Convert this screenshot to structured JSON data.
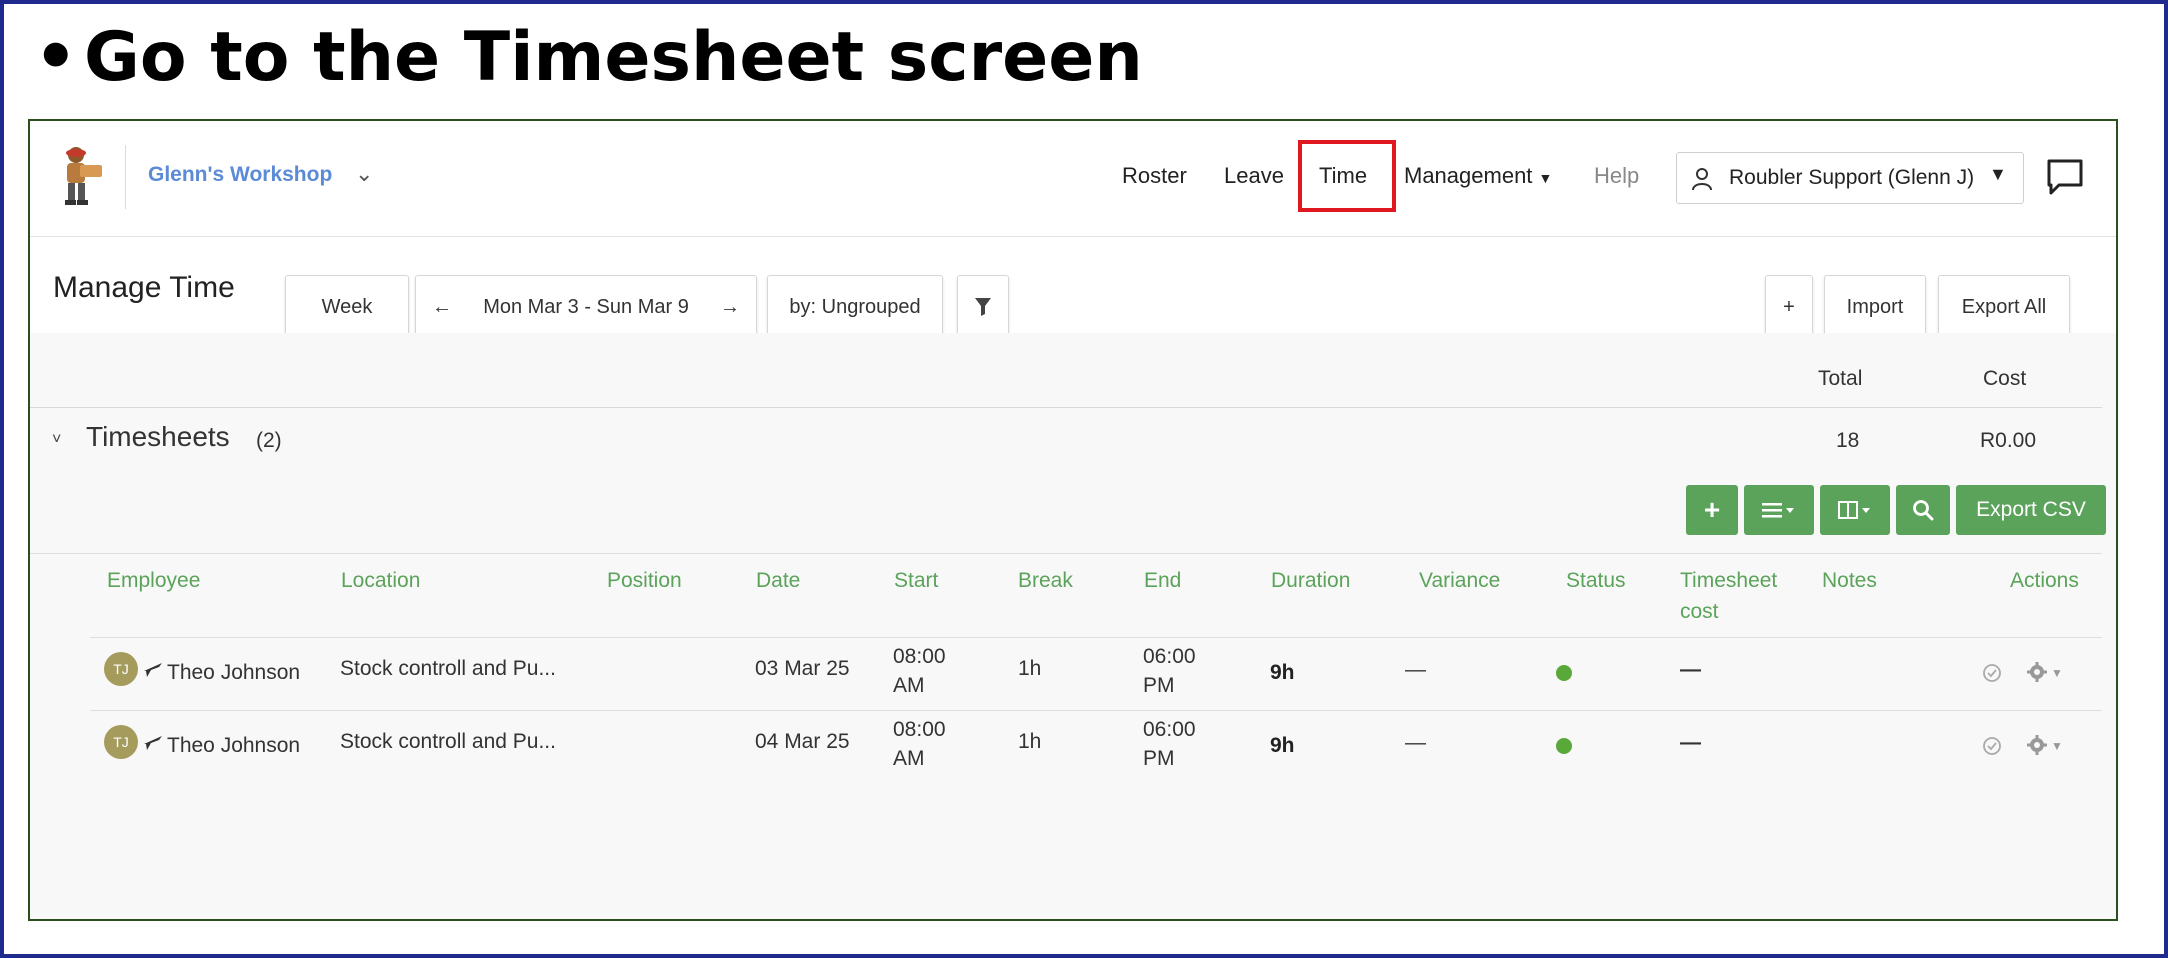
{
  "slide": {
    "bullet": "•",
    "title": "Go to the Timesheet screen"
  },
  "nav": {
    "workspace": "Glenn's Workshop",
    "items": [
      "Roster",
      "Leave",
      "Time",
      "Management",
      "Help"
    ],
    "highlighted_item": "Time",
    "user": "Roubler Support (Glenn J)"
  },
  "controls": {
    "page_title": "Manage Time",
    "period_button": "Week",
    "date_range": "Mon Mar 3 - Sun Mar 9",
    "prev_arrow": "←",
    "next_arrow": "→",
    "group_button": "by: Ungrouped",
    "add_button": "+",
    "import_button": "Import",
    "export_all_button": "Export All"
  },
  "summary": {
    "total_header": "Total",
    "cost_header": "Cost",
    "total_value": "18",
    "cost_value": "R0.00"
  },
  "section": {
    "caret": "˅",
    "title": "Timesheets",
    "count": "(2)"
  },
  "toolbar": {
    "add": "+",
    "export_csv": "Export CSV"
  },
  "table": {
    "headers": {
      "employee": "Employee",
      "location": "Location",
      "position": "Position",
      "date": "Date",
      "start": "Start",
      "break": "Break",
      "end": "End",
      "duration": "Duration",
      "variance": "Variance",
      "status": "Status",
      "timesheet_cost_1": "Timesheet",
      "timesheet_cost_2": "cost",
      "notes": "Notes",
      "actions": "Actions"
    },
    "rows": [
      {
        "initials": "TJ",
        "employee": "Theo Johnson",
        "location": "Stock controll and Pu...",
        "date": "03 Mar 25",
        "start_1": "08:00",
        "start_2": "AM",
        "break": "1h",
        "end_1": "06:00",
        "end_2": "PM",
        "duration": "9h",
        "variance": "—",
        "cost": "—"
      },
      {
        "initials": "TJ",
        "employee": "Theo Johnson",
        "location": "Stock controll and Pu...",
        "date": "04 Mar 25",
        "start_1": "08:00",
        "start_2": "AM",
        "break": "1h",
        "end_1": "06:00",
        "end_2": "PM",
        "duration": "9h",
        "variance": "—",
        "cost": "—"
      }
    ]
  },
  "colors": {
    "accent_green": "#5ba35a",
    "link_blue": "#5b8bd6",
    "highlight_red": "#e0181f",
    "status_green": "#58a83a",
    "frame_blue": "#1f2a8c"
  }
}
